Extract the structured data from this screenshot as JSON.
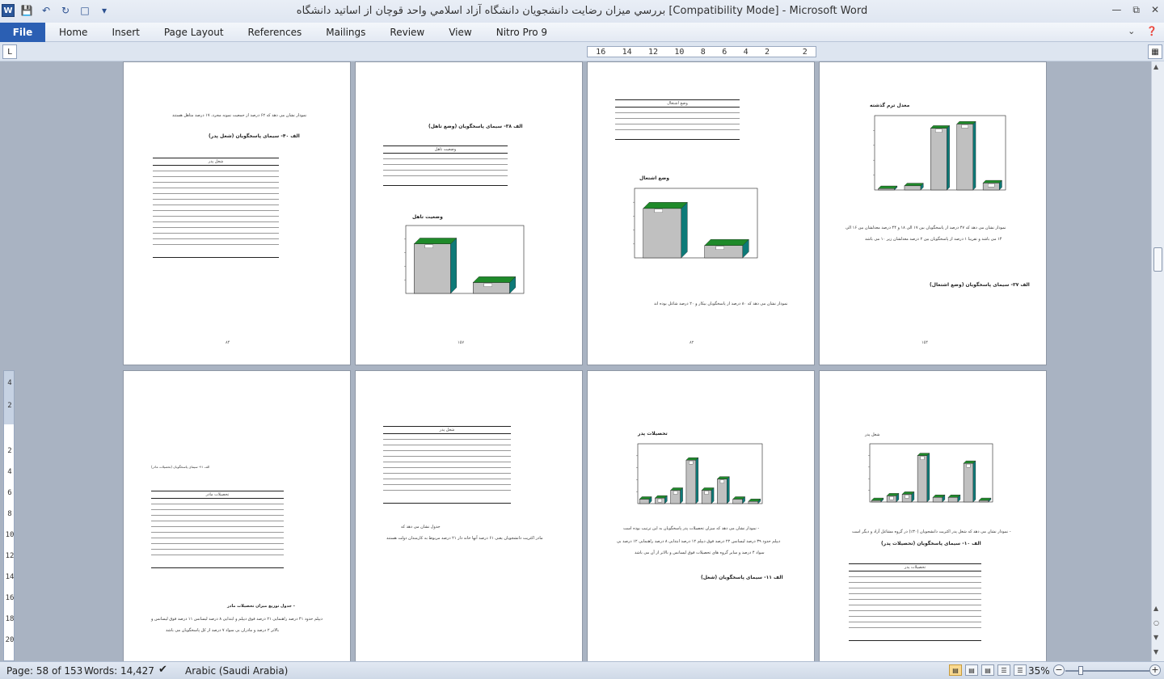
{
  "window": {
    "title": "بررسي ميزان رضايت دانشجويان دانشگاه آزاد اسلامي واحد قوچان از اساتيد دانشگاه [Compatibility Mode]  -  Microsoft Word",
    "app_icon": "W"
  },
  "ribbon": {
    "file_label": "File",
    "tabs": [
      "Home",
      "Insert",
      "Page Layout",
      "References",
      "Mailings",
      "Review",
      "View",
      "Nitro Pro 9"
    ]
  },
  "ruler": {
    "ticks": [
      "16",
      "14",
      "12",
      "10",
      "8",
      "6",
      "4",
      "2",
      "",
      "2"
    ],
    "vticks": [
      "4",
      "2",
      "",
      "2",
      "4",
      "6",
      "8",
      "10",
      "12",
      "14",
      "16",
      "18",
      "20"
    ]
  },
  "pages": {
    "p1": {
      "text1": "نمودار نشان می دهد که ۶۲ درصد از جمعیت نمونه مجرد، ۱۷ درصد متاهل هستند",
      "heading": "الف ۴۰- سیمای پاسخگویان (شغل پدر)",
      "table_caption": "شغل پدر",
      "number": "۸۴"
    },
    "p2": {
      "heading": "الف ۳۸- سیمای پاسخگویان (وضع تاهل)",
      "table_caption": "وضعیت تاهل",
      "chart_title": "وضعیت تاهل",
      "number": "۱۵۷"
    },
    "p3": {
      "table_caption": "وضع اشتغال",
      "chart_title": "وضع اشتغال",
      "text1": "نمودار نشان می دهد که ۸۰ درصد از پاسخگویان بیکار و ۲۰ درصد شاغل بوده اند",
      "number": "۸۲"
    },
    "p4": {
      "chart_title": "معدل ترم گذشته",
      "text1": "نمودار نشان می دهد که ۴۷ درصد از پاسخگویان بین ۱۷ الی ۱۸ و ۴۴ درصد معدلشان بین ۱۶ الی",
      "text2": "۱۴ می باشد و تقریبا ۱ درصد از پاسخگویان بین ۲ درصد معدلشان زیر ۱۰ می باشد",
      "heading": "الف ۳۷- سیمای پاسخگویان (وضع اشتغال)",
      "number": "۱۵۴"
    },
    "p5": {
      "small_heading": "الف ۴۱- سیمای پاسخگویان (تحصیلات مادر)",
      "table_caption": "تحصیلات مادر",
      "text1": "- جدول توزیع میزان تحصیلات مادر",
      "text2": "دیپلم حدود ۴۱ درصد راهنمایی ۲۱ درصد فوق دیپلم و ابتدایی ۸ درصد لیسانس ۱۱ درصد فوق لیسانس و",
      "text3": "بالاتر ۲ درصد و مادران بی سواد ۷ درصد از کل پاسخگویان می باشد"
    },
    "p6": {
      "table_caption": "شغل پدر",
      "text1": "جدول نشان می دهد که",
      "text2": "مادر اکثریت دانشجویان یعنی ۶۱ درصد آنها خانه دار ۲۱ درصد مربوط به کارمندان دولت هستند"
    },
    "p7": {
      "chart_title": "تحصیلات پدر",
      "text1": "- نمودار نشان می دهد که میزان تحصیلات پدر پاسخگویان به این ترتیب بوده است",
      "text2": "دیپلم حدود ۳۹ درصد لیسانس ۲۲ درصد فوق دیپلم ۱۲ درصد ابتدایی ۸ درصد راهنمایی ۱۲ درصد بی",
      "text3": "سواد ۴ درصد و سایر گروه های تحصیلات فوق لیسانس و بالاتر از آن می باشد",
      "heading": "الف ۱۱- سیمای پاسخگویان (شغل)"
    },
    "p8": {
      "chart_title": "شغل پدر",
      "text1": "- نمودار نشان می دهد که شغل پدر اکثریت دانشجویان (۳۰٪) در گروه مشاغل آزاد و دیگر است",
      "heading": "الف ۱۰- سیمای پاسخگویان (تحصیلات پدر)",
      "table_caption": "تحصیلات پدر"
    }
  },
  "status": {
    "page": "Page: 58 of 153",
    "words": "Words: 14,427",
    "language": "Arabic (Saudi Arabia)",
    "zoom": "35%"
  },
  "charts": {
    "p2": [
      82,
      18
    ],
    "p3": [
      80,
      20
    ],
    "p4": [
      1,
      3,
      44,
      47,
      5
    ],
    "p7": [
      4,
      5,
      12,
      39,
      12,
      22,
      4,
      2
    ],
    "p8": [
      1,
      4,
      5,
      30,
      3,
      3,
      25,
      1
    ]
  }
}
